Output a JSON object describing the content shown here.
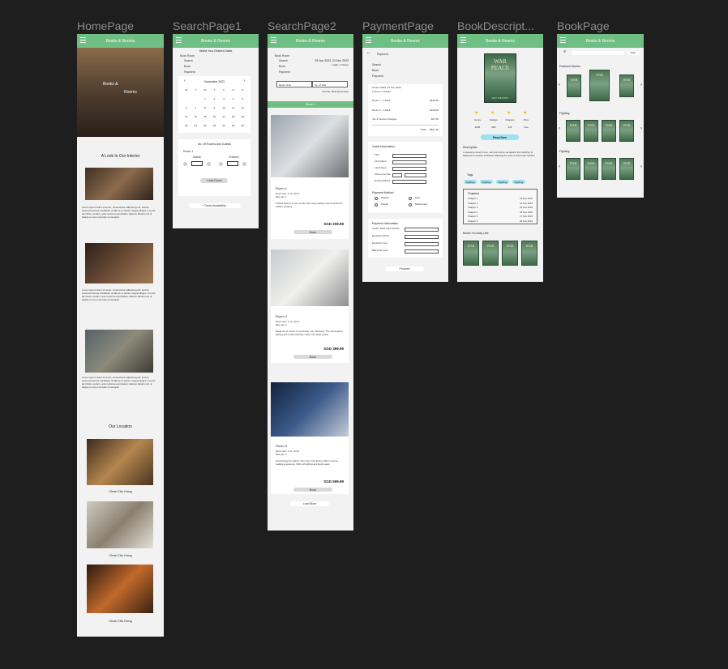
{
  "frames": {
    "home_title": "HomePage",
    "search1_title": "SearchPage1",
    "search2_title": "SearchPage2",
    "payment_title": "PaymentPage",
    "bookdesc_title": "BookDescript...",
    "book_title": "BookPage"
  },
  "app": {
    "name": "Books & Rooms"
  },
  "home": {
    "hero_line1": "Books &",
    "hero_line2": "Rooms",
    "section_title": "A Look In Our Interior",
    "lorem": "Lorem ipsum dolor sit amet, consectetur adipiscing elit, sed do eiusmod tempor incididunt ut labore et dolore magna aliqua. Ut enim ad minim veniam, quis nostrud exercitation ullamco laboris nisi ut aliquip ex ea commodo consequat.",
    "location_title": "Our Location",
    "location_caption": "Chae Chu Kong"
  },
  "search1": {
    "heading": "Select Your Desired Dates",
    "steps": [
      "Book Room",
      "Search",
      "Book",
      "Payment"
    ],
    "month": "November 2023",
    "weekdays": [
      "M",
      "T",
      "W",
      "T",
      "F",
      "S",
      "S"
    ],
    "days": [
      "",
      "",
      "1",
      "2",
      "3",
      "4",
      "5",
      "6",
      "7",
      "8",
      "9",
      "10",
      "11",
      "12",
      "13",
      "14",
      "15",
      "16",
      "17",
      "18",
      "19",
      "20",
      "21",
      "22",
      "23",
      "24",
      "25",
      "26"
    ],
    "guests_title": "No. Of Rooms and Guests",
    "room_label": "Room 1",
    "adults": "Adults",
    "children": "Children",
    "add_room": "+ Add Room",
    "check_btn": "Check Availability"
  },
  "search2": {
    "steps": [
      "Book Room",
      "Search",
      "Book",
      "Payment"
    ],
    "dates": "23 Nov 2023, 24 Nov 2023",
    "nights": "1 night, 2 Visitors",
    "room_count": "Room Only",
    "pax": "No. of Pax",
    "sort": "Sort By: Most Expensive",
    "room_tab": "Room 1",
    "rooms": [
      {
        "name": "Room 1",
        "meta1": "Room size: 2 m² / 22 ft²",
        "meta2": "Max pax: 1",
        "desc": "Tucked away in a cozy corner, this snug reading nook is perfect for solitary escapes.",
        "price": "SGD 209.99",
        "btn": "Book"
      },
      {
        "name": "Room 2",
        "meta1": "Room size: 2 m² / 22 ft²",
        "meta2": "Max pax: 2",
        "desc": "Break out of routine in a perfectly cozy sanctuary. The soft ambient lighting and curated shelves make it the ideal retreat.",
        "price": "SGD 399.99",
        "btn": "Book"
      },
      {
        "name": "Room 3",
        "meta1": "Room size: 3 m² / 33 ft²",
        "meta2": "Max pax: 2",
        "desc": "Overlooking the skyline, this nook in the library offers a serene reading experience. With soft lighting and plush seats.",
        "price": "SGD 599.99",
        "btn": "Book"
      }
    ],
    "load_more": "Load More"
  },
  "payment": {
    "back_label": "Payment",
    "steps": [
      "Search",
      "Book",
      "Payment"
    ],
    "summary_line1": "23 Nov 2023, 24 Nov 2023",
    "summary_line2": "1 Room, 2 Adults",
    "rows": [
      {
        "label": "Room 1 - 1 Adult",
        "value": "$199.99"
      },
      {
        "label": "Room 2 - 1 Adult",
        "value": "$299.99"
      },
      {
        "label": "Tax & Service Charges",
        "value": "$27.50"
      }
    ],
    "total_label": "Total",
    "total_value": "$527.48",
    "guest_title": "Guest Information",
    "guest_fields": [
      "Title",
      "First Name",
      "Last Name",
      "Phone Number",
      "Email Address"
    ],
    "method_title": "Payment Method",
    "methods": [
      "PayPal",
      "Visa",
      "Paylah",
      "Mastercard"
    ],
    "card_title": "Payment Information",
    "card_fields": [
      "Credit / Debit Card Number",
      "Expiration Month",
      "Expiration Year",
      "Billing Zip Code"
    ],
    "proceed": "Proceed"
  },
  "bookdesc": {
    "cover_title": "WAR PEACE",
    "cover_author": "LEO TOLSTOY",
    "stats_labels": [
      "Genre",
      "Ratings",
      "Chapters",
      "Price"
    ],
    "stats_values": [
      "ROM",
      "95%",
      "200",
      "Free"
    ],
    "read_btn": "Read Now",
    "desc_title": "Description",
    "desc": "A sweeping novel of love, war and society set against the backdrop of Napoleon's invasion of Russia, following the lives of aristocratic families.",
    "tags_title": "Tags",
    "tags": [
      "Fighting",
      "Fighting",
      "Fighting",
      "Fighting"
    ],
    "chapters_title": "Chapters",
    "chapters": [
      "Chapter 1",
      "Chapter 2",
      "Chapter 3",
      "Chapter 4",
      "Chapter 5",
      "Chapter 6"
    ],
    "chapter_dates": [
      "13 Nov 2023",
      "14 Nov 2023",
      "15 Nov 2023",
      "16 Nov 2023",
      "17 Nov 2023",
      "18 Nov 2023"
    ],
    "similar_title": "Books You May Like"
  },
  "bookpage": {
    "filter": "Filter",
    "featured": "Featured Stories",
    "section1": "Fighting",
    "section2": "Fighting"
  }
}
